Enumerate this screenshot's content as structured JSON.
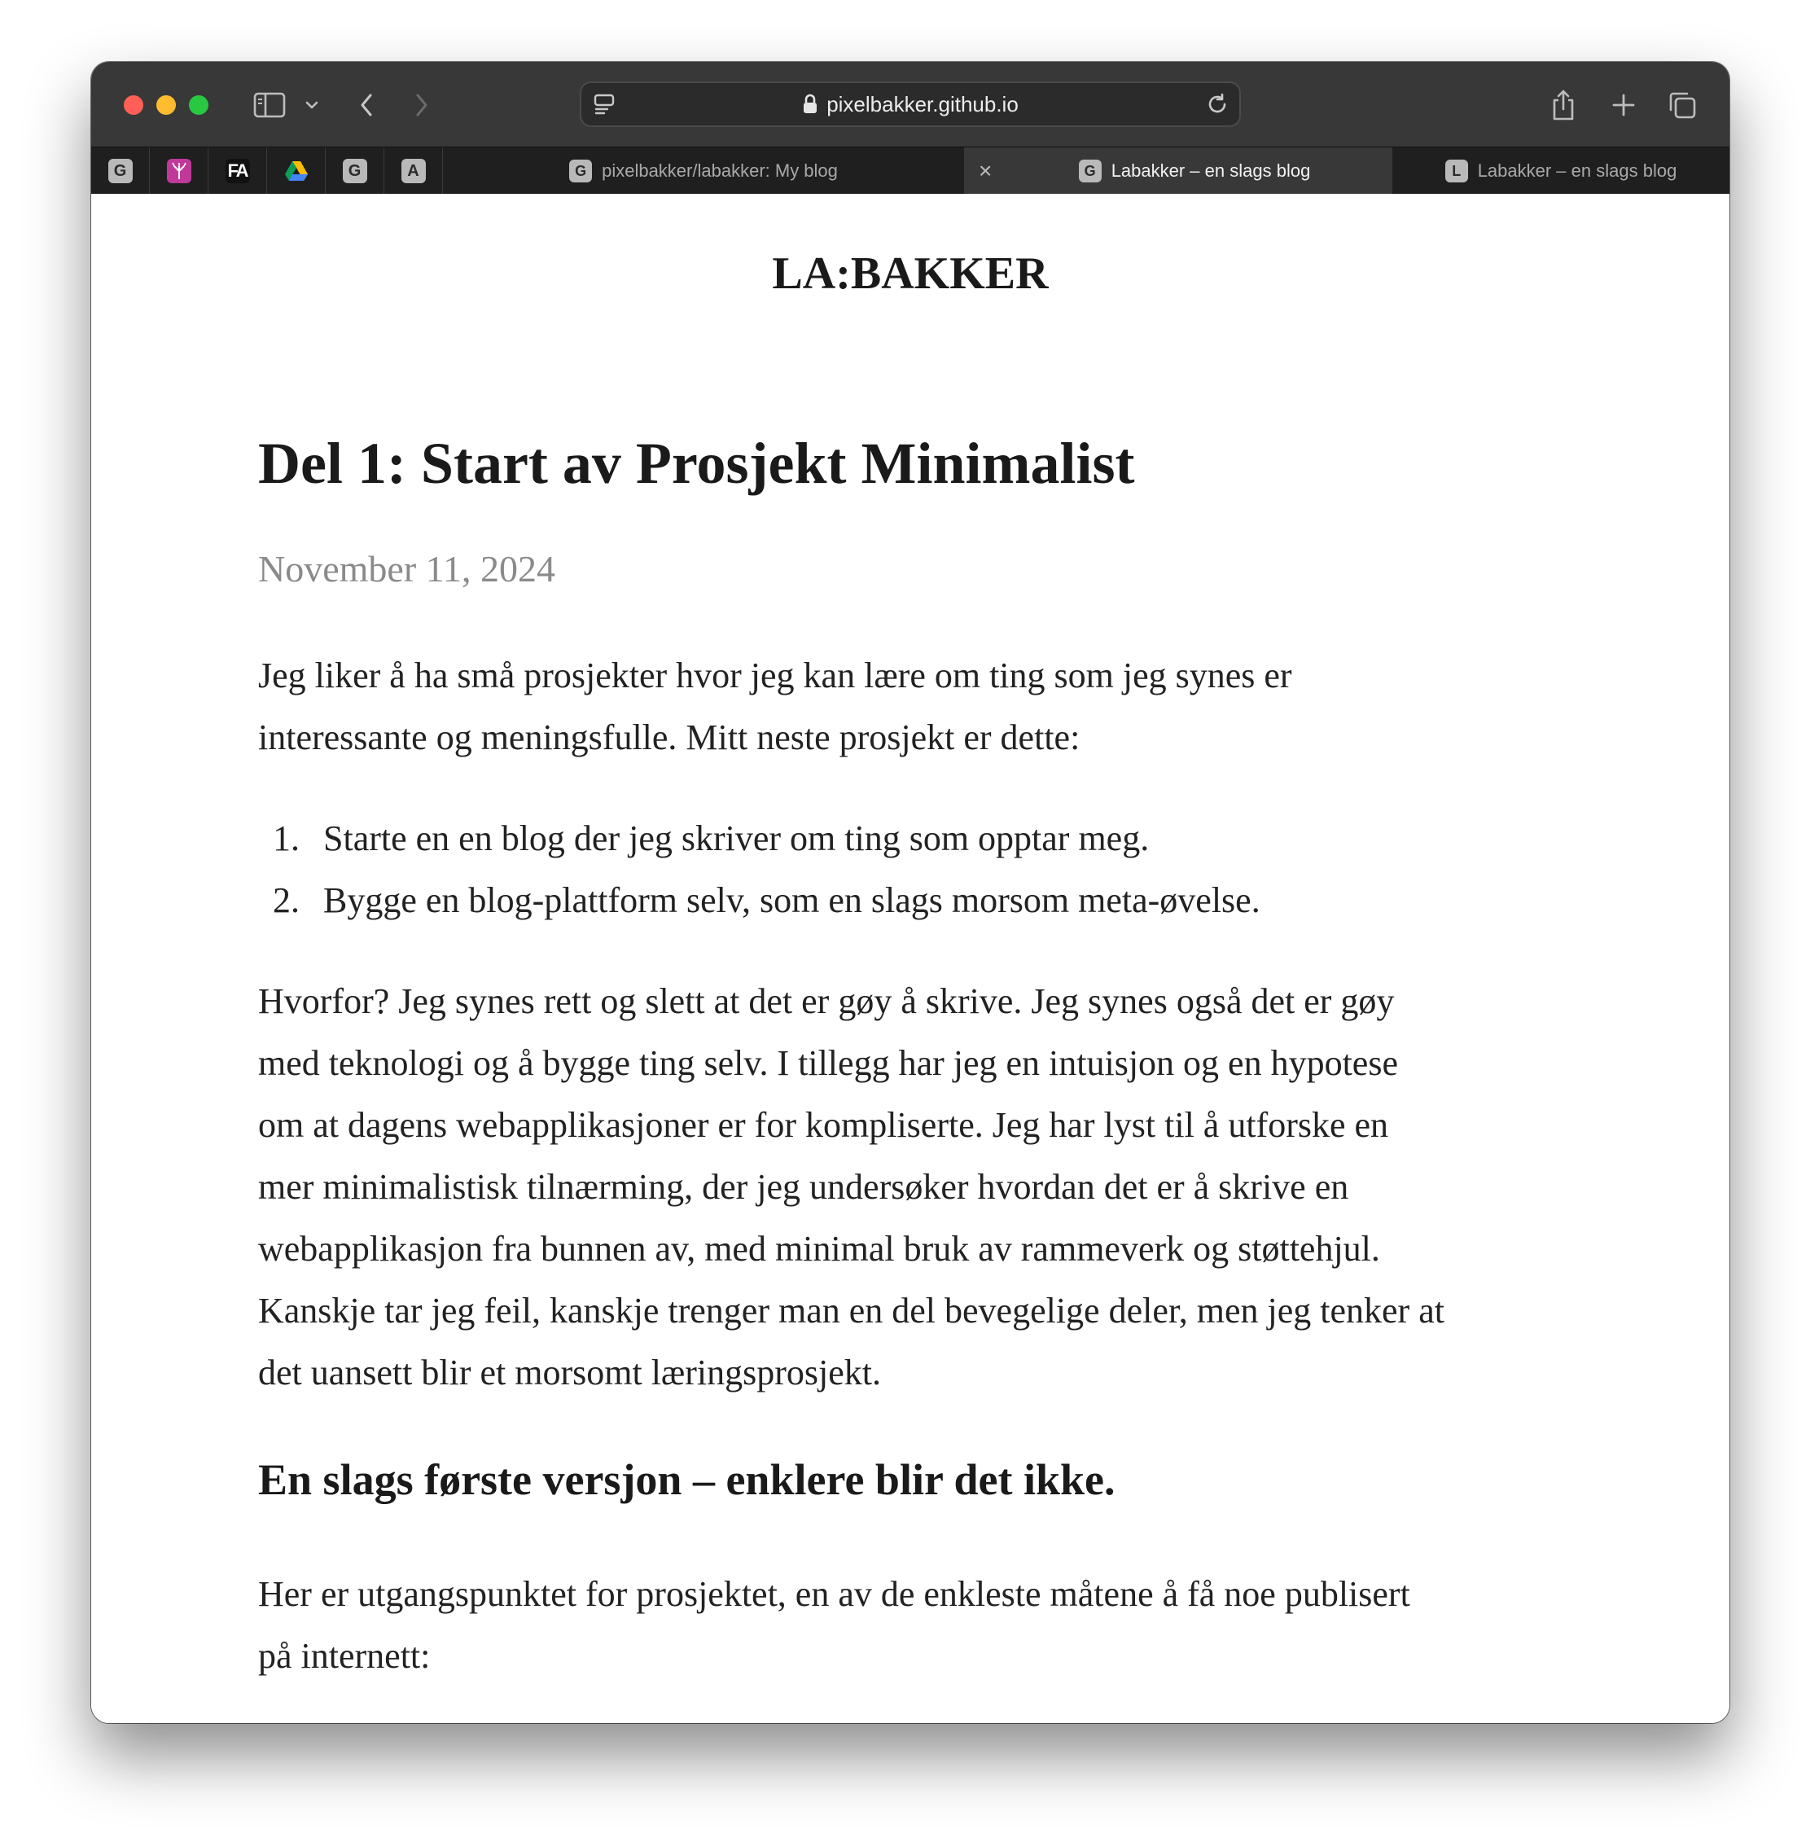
{
  "browser": {
    "url": "pixelbakker.github.io",
    "pinned_tabs": [
      {
        "letter": "G",
        "bg": "#b0b0b0"
      },
      {
        "letter": "",
        "bg": "#c0399a"
      },
      {
        "letter": "FA",
        "bg": "#111111"
      },
      {
        "letter": "",
        "bg": "#1f1f1f"
      },
      {
        "letter": "G",
        "bg": "#b0b0b0"
      },
      {
        "letter": "A",
        "bg": "#b0b0b0"
      }
    ],
    "tabs": [
      {
        "favicon": "G",
        "label": "pixelbakker/labakker: My blog"
      },
      {
        "favicon": "G",
        "label": "Labakker – en slags blog"
      },
      {
        "favicon": "L",
        "label": "Labakker – en slags blog"
      }
    ],
    "close_symbol": "×"
  },
  "page": {
    "site_title": "LA:BAKKER",
    "post_title": "Del 1: Start av Prosjekt Minimalist",
    "date": "November 11, 2024",
    "intro_lines": [
      "Jeg liker å ha små prosjekter hvor jeg kan lære om ting som jeg synes er",
      "interessante og meningsfulle. Mitt neste prosjekt er dette:"
    ],
    "list": [
      {
        "num": "1.",
        "text": "Starte en en blog der jeg skriver om ting som opptar meg."
      },
      {
        "num": "2.",
        "text": "Bygge en blog-plattform selv, som en slags morsom meta-øvelse."
      }
    ],
    "why_lines": [
      "Hvorfor? Jeg synes rett og slett at det er gøy å skrive. Jeg synes også det er gøy",
      "med teknologi og å bygge ting selv. I tillegg har jeg en intuisjon og en hypotese",
      "om at dagens webapplikasjoner er for kompliserte. Jeg har lyst til å utforske en",
      "mer minimalistisk tilnærming, der jeg undersøker hvordan det er å skrive en",
      "webapplikasjon fra bunnen av, med minimal bruk av rammeverk og støttehjul.",
      "Kanskje tar jeg feil, kanskje trenger man en del bevegelige deler, men jeg tenker at",
      "det uansett blir et morsomt læringsprosjekt."
    ],
    "section_heading": "En slags første versjon – enklere blir det ikke.",
    "section_lines": [
      "Her er utgangspunktet for prosjektet, en av de enkleste måtene å få noe publisert",
      "på internett:"
    ]
  }
}
